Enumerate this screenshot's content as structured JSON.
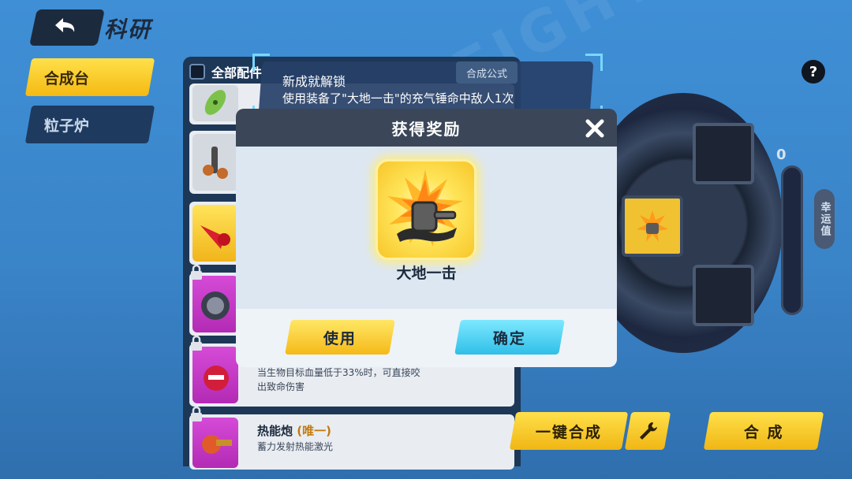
{
  "header": {
    "title": "科研"
  },
  "tabs": [
    {
      "label": "合成台",
      "active": true
    },
    {
      "label": "粒子炉",
      "active": false
    }
  ],
  "parts_list": {
    "header_label": "全部配件",
    "items": [
      {
        "title": "",
        "tag": "",
        "description": []
      },
      {
        "title": "",
        "tag": "",
        "description": []
      },
      {
        "title": "",
        "tag": "",
        "description": []
      },
      {
        "title": "",
        "tag": "",
        "description": [],
        "locked": true
      },
      {
        "title": "",
        "tag": "",
        "description": [
          "当生物目标血量低于33%时，可直接咬",
          "出致命伤害"
        ],
        "locked": true
      },
      {
        "title": "热能炮",
        "tag": "(唯一)",
        "description": [
          "蓄力发射热能激光"
        ],
        "locked": true
      }
    ]
  },
  "notification": {
    "title": "新成就解锁",
    "description": "使用装备了\"大地一击\"的充气锤命中敌人1次",
    "recipe_button": "合成公式"
  },
  "crafting": {
    "luck_value": "0",
    "luck_label": "幸运值",
    "one_click_button": "一键合成",
    "craft_button": "合 成",
    "help_icon": "?"
  },
  "dialog": {
    "title": "获得奖励",
    "reward_name": "大地一击",
    "use_button": "使用",
    "confirm_button": "确定"
  },
  "colors": {
    "accent_yellow": "#f5b912",
    "accent_cyan": "#2fbfe8",
    "dark_panel": "#1d3757",
    "rarity_purple": "#b32ab5"
  }
}
